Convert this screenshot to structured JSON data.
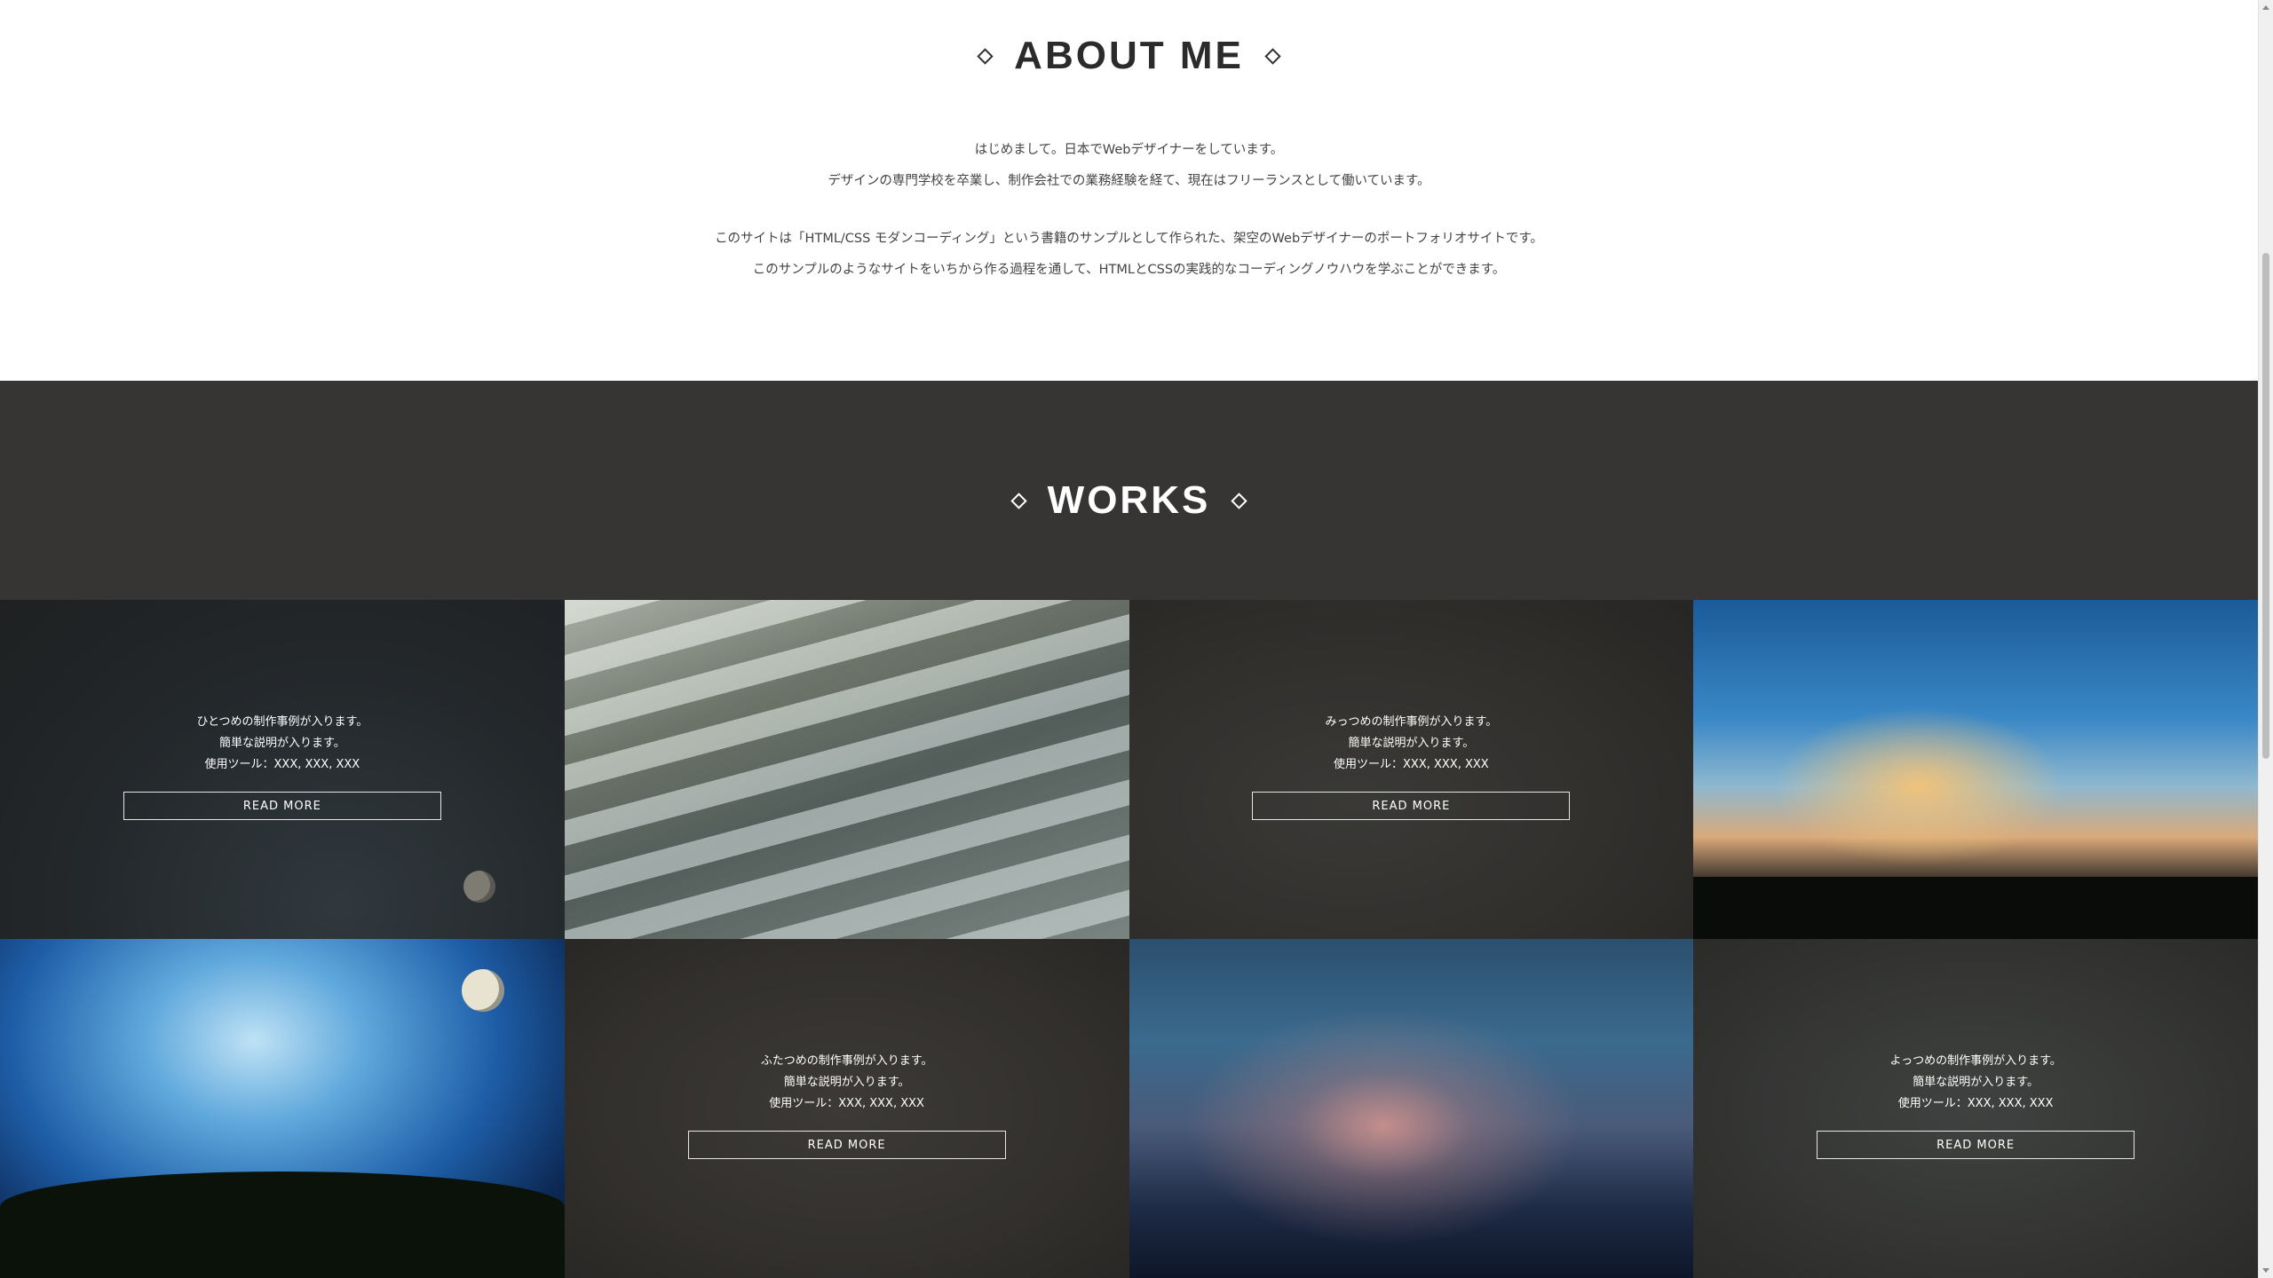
{
  "about": {
    "title": "ABOUT ME",
    "line1": "はじめまして。日本でWebデザイナーをしています。",
    "line2": "デザインの専門学校を卒業し、制作会社での業務経験を経て、現在はフリーランスとして働いています。",
    "line3": "このサイトは「HTML/CSS モダンコーディング」という書籍のサンプルとして作られた、架空のWebデザイナーのポートフォリオサイトです。",
    "line4": "このサンプルのようなサイトをいちから作る過程を通して、HTMLとCSSの実践的なコーディングノウハウを学ぶことができます。"
  },
  "works": {
    "title": "WORKS",
    "items": [
      {
        "line1": "ひとつめの制作事例が入ります。",
        "line2": "簡単な説明が入ります。",
        "line3": "使用ツール：XXX, XXX, XXX",
        "button": "READ MORE"
      },
      {
        "line1": "みっつめの制作事例が入ります。",
        "line2": "簡単な説明が入ります。",
        "line3": "使用ツール：XXX, XXX, XXX",
        "button": "READ MORE"
      },
      {
        "line1": "ふたつめの制作事例が入ります。",
        "line2": "簡単な説明が入ります。",
        "line3": "使用ツール：XXX, XXX, XXX",
        "button": "READ MORE"
      },
      {
        "line1": "よっつめの制作事例が入ります。",
        "line2": "簡単な説明が入ります。",
        "line3": "使用ツール：XXX, XXX, XXX",
        "button": "READ MORE"
      }
    ]
  }
}
